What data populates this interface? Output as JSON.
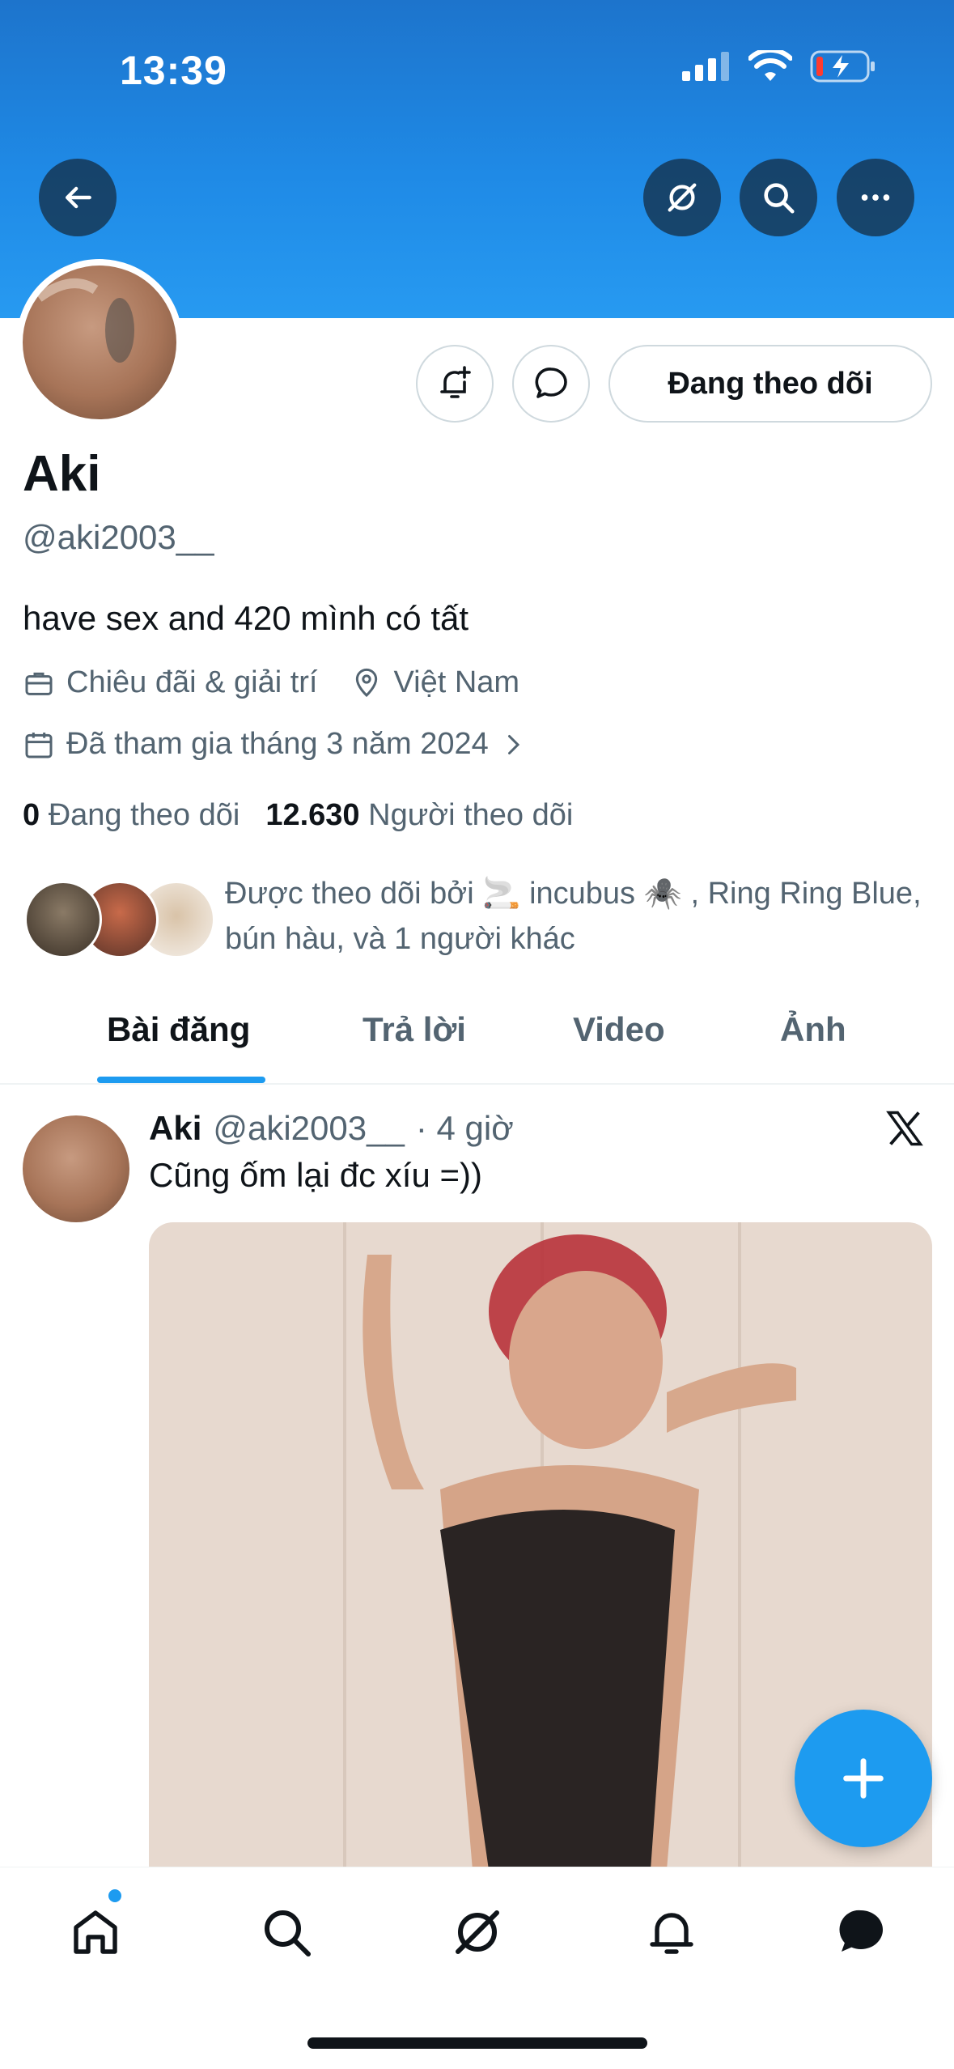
{
  "status_bar": {
    "time": "13:39"
  },
  "profile": {
    "name": "Aki",
    "handle": "@aki2003__",
    "bio": "have sex and 420 mình có tất",
    "category": "Chiêu đãi & giải trí",
    "location": "Việt Nam",
    "joined": "Đã tham gia tháng 3 năm 2024",
    "following_count": "0",
    "following_label": "Đang theo dõi",
    "followers_count": "12.630",
    "followers_label": "Người theo dõi",
    "followed_by": "Được theo dõi bởi 🚬 incubus 🕷️ , Ring Ring Blue, bún hàu, và 1 người khác",
    "follow_button_label": "Đang theo dõi"
  },
  "tabs": [
    {
      "label": "Bài đăng",
      "active": true
    },
    {
      "label": "Trả lời",
      "active": false
    },
    {
      "label": "Video",
      "active": false
    },
    {
      "label": "Ảnh",
      "active": false
    }
  ],
  "tweet": {
    "author_name": "Aki",
    "author_handle": "@aki2003__",
    "time": "· 4 giờ",
    "text": "Cũng ốm lại đc xíu =))"
  },
  "bottom_nav": [
    "home-icon",
    "search-icon",
    "grok-icon",
    "bell-icon",
    "messages-icon"
  ],
  "colors": {
    "accent": "#1d9bf0",
    "banner": "#1f8ae6",
    "text_secondary": "#536471"
  }
}
